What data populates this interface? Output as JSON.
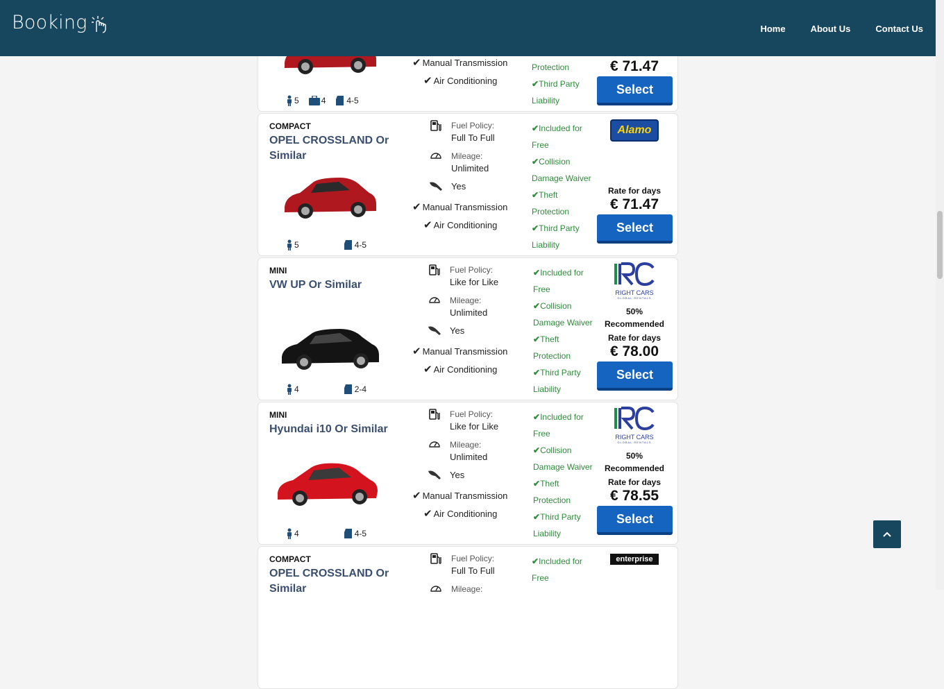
{
  "header": {
    "logo": "Booking",
    "nav": [
      "Home",
      "About Us",
      "Contact Us"
    ]
  },
  "cards": [
    {
      "category": "",
      "name": "",
      "car_color": "#b01820",
      "passengers": "5",
      "bags": "4",
      "doors": "4-5",
      "transmission": "Manual Transmission",
      "ac": "Air Conditioning",
      "included": [
        "Protection",
        "Third Party",
        "Liability"
      ],
      "supplier": "",
      "rate_label": "",
      "price": "€ 71.47",
      "select": "Select"
    },
    {
      "category": "COMPACT",
      "name": "OPEL CROSSLAND Or Similar",
      "car_color": "#b01820",
      "fuel_label": "Fuel Policy:",
      "fuel_value": "Full To Full",
      "mileage_label": "Mileage:",
      "mileage_value": "Unlimited",
      "key_value": "Yes",
      "transmission": "Manual Transmission",
      "ac": "Air Conditioning",
      "passengers": "5",
      "doors": "4-5",
      "included": [
        "Included for",
        "Free",
        "Collision",
        "Damage Waiver",
        "Theft",
        "Protection",
        "Third Party",
        "Liability"
      ],
      "supplier": "Alamo",
      "rate_label": "Rate for days",
      "price": "€ 71.47",
      "select": "Select"
    },
    {
      "category": "MINI",
      "name": "VW UP Or Similar",
      "car_color": "#141414",
      "fuel_label": "Fuel Policy:",
      "fuel_value": "Like for Like",
      "mileage_label": "Mileage:",
      "mileage_value": "Unlimited",
      "key_value": "Yes",
      "transmission": "Manual Transmission",
      "ac": "Air Conditioning",
      "passengers": "4",
      "doors": "2-4",
      "included": [
        "Included for",
        "Free",
        "Collision",
        "Damage Waiver",
        "Theft",
        "Protection",
        "Third Party",
        "Liability"
      ],
      "supplier": "RIGHT CARS",
      "supplier_sub": "GLOBAL RENTALS",
      "recommend_pct": "50%",
      "recommend_label": "Recommended",
      "rate_label": "Rate for days",
      "price": "€ 78.00",
      "select": "Select"
    },
    {
      "category": "MINI",
      "name": "Hyundai i10 Or Similar",
      "car_color": "#d3141e",
      "fuel_label": "Fuel Policy:",
      "fuel_value": "Like for Like",
      "mileage_label": "Mileage:",
      "mileage_value": "Unlimited",
      "key_value": "Yes",
      "transmission": "Manual Transmission",
      "ac": "Air Conditioning",
      "passengers": "4",
      "doors": "4-5",
      "included": [
        "Included for",
        "Free",
        "Collision",
        "Damage Waiver",
        "Theft",
        "Protection",
        "Third Party",
        "Liability"
      ],
      "supplier": "RIGHT CARS",
      "supplier_sub": "GLOBAL RENTALS",
      "recommend_pct": "50%",
      "recommend_label": "Recommended",
      "rate_label": "Rate for days",
      "price": "€ 78.55",
      "select": "Select"
    },
    {
      "category": "COMPACT",
      "name": "OPEL CROSSLAND Or Similar",
      "fuel_label": "Fuel Policy:",
      "fuel_value": "Full To Full",
      "mileage_label": "Mileage:",
      "included": [
        "Included for",
        "Free"
      ],
      "supplier": "enterprise"
    }
  ],
  "colors": {
    "header_bg": "#17465f",
    "select_bg": "#1565c0",
    "included_green": "#2e8b3a",
    "car_name": "#3a4e6e"
  },
  "icons": {
    "fuel": "fuel-pump-icon",
    "mileage": "speedometer-icon",
    "key": "car-key-icon",
    "passenger": "person-icon",
    "bag": "suitcase-icon",
    "door": "car-door-icon",
    "check": "check-icon",
    "scroll_top": "chevron-up-icon"
  }
}
